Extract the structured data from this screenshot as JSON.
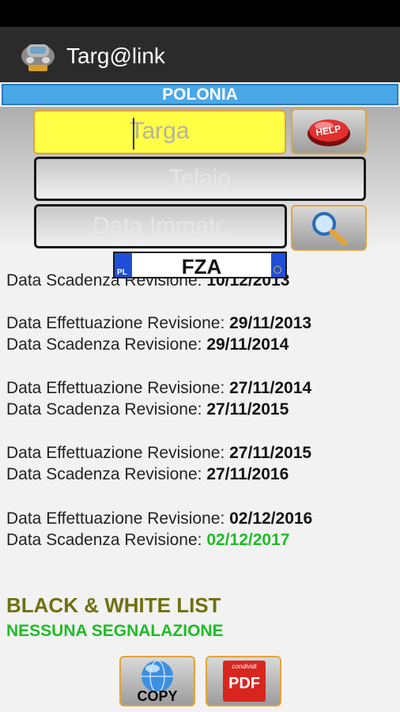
{
  "app": {
    "title": "Targ@link"
  },
  "country": "POLONIA",
  "form": {
    "targa_placeholder": "Targa",
    "telaio_placeholder": "Telaio",
    "data_placeholder": "Data Immatr.",
    "help_label": "HELP"
  },
  "plate": {
    "country_code": "PL",
    "text": "FZA"
  },
  "records": [
    {
      "label": "Data Scadenza Revisione:",
      "value": "10/12/2013"
    },
    {
      "label": "Data Effettuazione Revisione:",
      "value": "29/11/2013"
    },
    {
      "label": "Data Scadenza Revisione:",
      "value": "29/11/2014"
    },
    {
      "label": "Data Effettuazione Revisione:",
      "value": "27/11/2014"
    },
    {
      "label": "Data Scadenza Revisione:",
      "value": "27/11/2015"
    },
    {
      "label": "Data Effettuazione Revisione:",
      "value": "27/11/2015"
    },
    {
      "label": "Data Scadenza Revisione:",
      "value": "27/11/2016"
    },
    {
      "label": "Data Effettuazione Revisione:",
      "value": "02/12/2016"
    },
    {
      "label": "Data Scadenza Revisione:",
      "value": "02/12/2017"
    }
  ],
  "list": {
    "title": "BLACK & WHITE LIST",
    "status": "NESSUNA SEGNALAZIONE"
  },
  "buttons": {
    "copy_label": "COPY",
    "pdf_top": "condividi",
    "pdf_label": "PDF"
  },
  "colors": {
    "accent": "#e2a43a",
    "country_bar": "#4aa7e8",
    "ok": "#1ebc27",
    "targa_bg": "#ffff46"
  }
}
